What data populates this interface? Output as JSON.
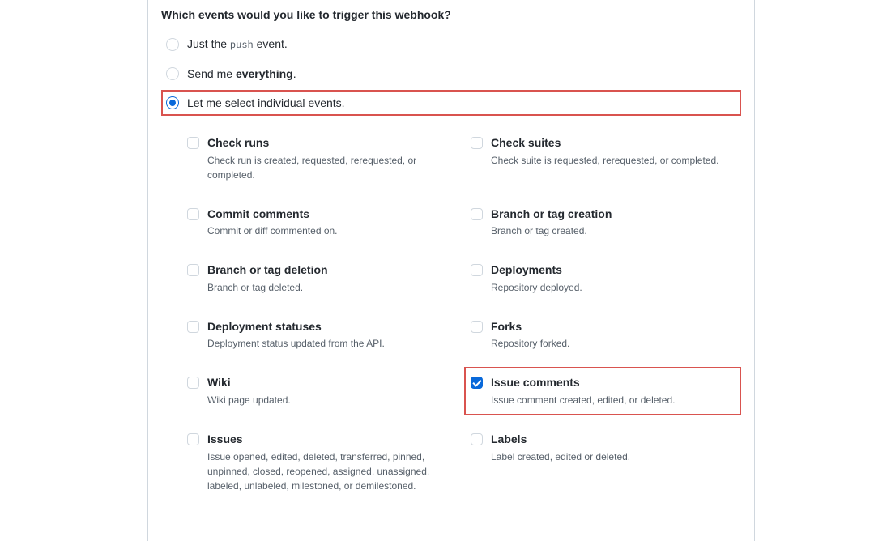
{
  "question": "Which events would you like to trigger this webhook?",
  "radios": {
    "push_prefix": "Just the ",
    "push_code": "push",
    "push_suffix": " event.",
    "everything_prefix": "Send me ",
    "everything_strong": "everything",
    "everything_suffix": ".",
    "individual": "Let me select individual events."
  },
  "events": {
    "check_runs": {
      "title": "Check runs",
      "desc": "Check run is created, requested, rerequested, or completed."
    },
    "check_suites": {
      "title": "Check suites",
      "desc": "Check suite is requested, rerequested, or completed."
    },
    "commit_comments": {
      "title": "Commit comments",
      "desc": "Commit or diff commented on."
    },
    "branch_tag_creation": {
      "title": "Branch or tag creation",
      "desc": "Branch or tag created."
    },
    "branch_tag_deletion": {
      "title": "Branch or tag deletion",
      "desc": "Branch or tag deleted."
    },
    "deployments": {
      "title": "Deployments",
      "desc": "Repository deployed."
    },
    "deployment_statuses": {
      "title": "Deployment statuses",
      "desc": "Deployment status updated from the API."
    },
    "forks": {
      "title": "Forks",
      "desc": "Repository forked."
    },
    "wiki": {
      "title": "Wiki",
      "desc": "Wiki page updated."
    },
    "issue_comments": {
      "title": "Issue comments",
      "desc": "Issue comment created, edited, or deleted."
    },
    "issues": {
      "title": "Issues",
      "desc": "Issue opened, edited, deleted, transferred, pinned, unpinned, closed, reopened, assigned, unassigned, labeled, unlabeled, milestoned, or demilestoned."
    },
    "labels": {
      "title": "Labels",
      "desc": "Label created, edited or deleted."
    }
  }
}
